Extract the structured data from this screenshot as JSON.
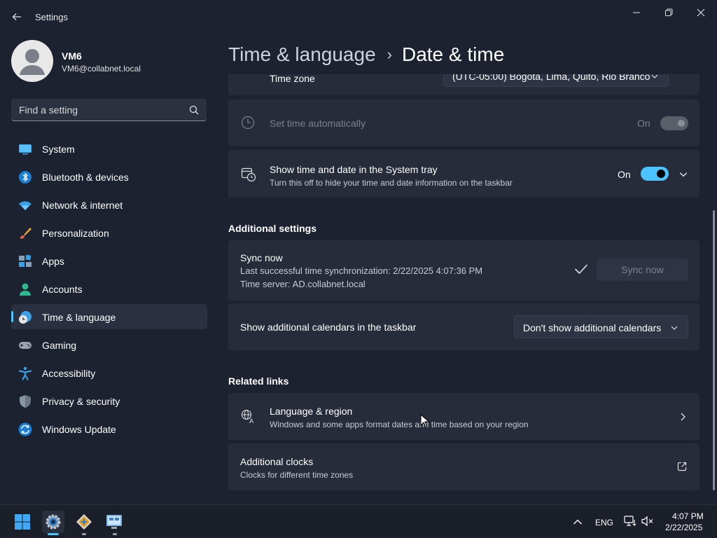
{
  "window": {
    "title": "Settings"
  },
  "user": {
    "name": "VM6",
    "email": "VM6@collabnet.local"
  },
  "search": {
    "placeholder": "Find a setting"
  },
  "nav": [
    {
      "label": "System",
      "icon": "system-icon"
    },
    {
      "label": "Bluetooth & devices",
      "icon": "bluetooth-icon"
    },
    {
      "label": "Network & internet",
      "icon": "wifi-icon"
    },
    {
      "label": "Personalization",
      "icon": "brush-icon"
    },
    {
      "label": "Apps",
      "icon": "apps-icon"
    },
    {
      "label": "Accounts",
      "icon": "person-icon"
    },
    {
      "label": "Time & language",
      "icon": "clock-globe-icon",
      "active": true
    },
    {
      "label": "Gaming",
      "icon": "gamepad-icon"
    },
    {
      "label": "Accessibility",
      "icon": "accessibility-icon"
    },
    {
      "label": "Privacy & security",
      "icon": "shield-icon"
    },
    {
      "label": "Windows Update",
      "icon": "update-icon"
    }
  ],
  "breadcrumb": {
    "parent": "Time & language",
    "separator": "›",
    "current": "Date & time"
  },
  "settings": {
    "time_zone": {
      "label": "Time zone",
      "value": "(UTC-05:00) Bogota, Lima, Quito, Rio Branco"
    },
    "set_time_auto": {
      "label": "Set time automatically",
      "state": "On",
      "enabled": false
    },
    "show_tray": {
      "label": "Show time and date in the System tray",
      "description": "Turn this off to hide your time and date information on the taskbar",
      "state": "On"
    }
  },
  "additional": {
    "title": "Additional settings",
    "sync": {
      "label": "Sync now",
      "last_sync": "Last successful time synchronization: 2/22/2025 4:07:36 PM",
      "server": "Time server: AD.collabnet.local",
      "button": "Sync now"
    },
    "calendars": {
      "label": "Show additional calendars in the taskbar",
      "value": "Don't show additional calendars"
    }
  },
  "related": {
    "title": "Related links",
    "language_region": {
      "label": "Language & region",
      "description": "Windows and some apps format dates and time based on your region"
    },
    "additional_clocks": {
      "label": "Additional clocks",
      "description": "Clocks for different time zones"
    }
  },
  "taskbar": {
    "language": "ENG",
    "time": "4:07 PM",
    "date": "2/22/2025"
  },
  "colors": {
    "accent": "#4cc2ff",
    "background": "#1d2230",
    "card": "#272c3a"
  }
}
